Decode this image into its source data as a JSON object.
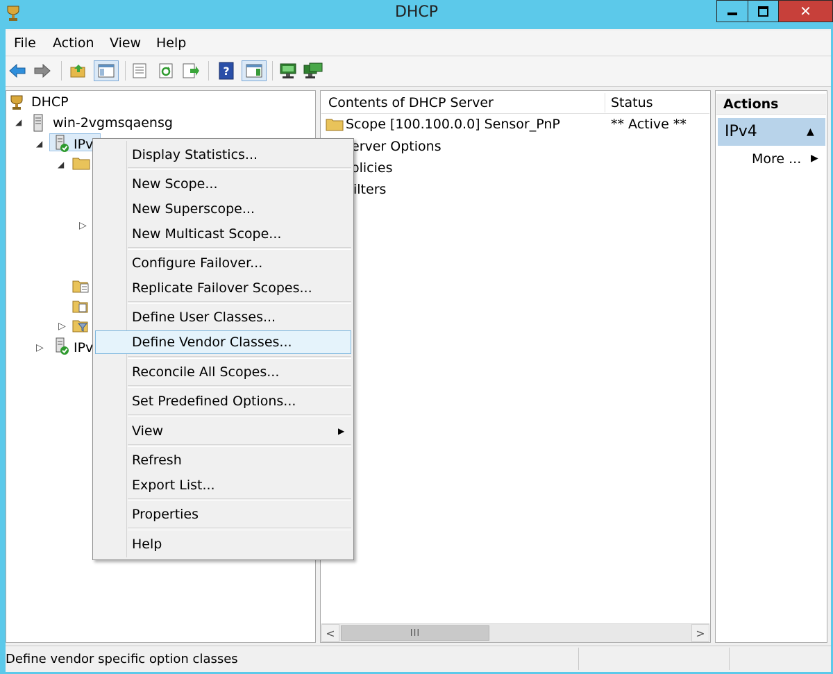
{
  "window": {
    "title": "DHCP",
    "controls": {
      "minimize": "minimize-icon",
      "maximize": "maximize-icon",
      "close": "close-icon"
    }
  },
  "menubar": {
    "items": [
      {
        "label": "File"
      },
      {
        "label": "Action"
      },
      {
        "label": "View"
      },
      {
        "label": "Help"
      }
    ]
  },
  "toolbar": {
    "buttons": [
      "back-arrow-icon",
      "forward-arrow-icon",
      "up-folder-icon",
      "show-hide-console-tree-icon",
      "properties-icon",
      "refresh-icon",
      "export-list-icon",
      "help-icon",
      "show-hide-action-pane-icon",
      "authorize-server-icon",
      "unauthorize-server-icon"
    ]
  },
  "tree": {
    "root": "DHCP",
    "server": "win-2vgmsqaensg",
    "ipv4": "IPv4",
    "ipv4_visible": "IPv",
    "ipv6_visible": "IPv"
  },
  "content": {
    "columns": [
      "Contents of DHCP Server",
      "Status"
    ],
    "rows": [
      {
        "name": "Scope [100.100.0.0] Sensor_PnP",
        "status": "** Active **"
      },
      {
        "name_visible": "erver Options",
        "status": ""
      },
      {
        "name_visible": "olicies",
        "status": ""
      },
      {
        "name_visible": "ilters",
        "status": ""
      }
    ]
  },
  "context_menu": {
    "items": [
      {
        "label": "Display Statistics..."
      },
      {
        "label": "New Scope..."
      },
      {
        "label": "New Superscope..."
      },
      {
        "label": "New Multicast Scope..."
      },
      {
        "label": "Configure Failover..."
      },
      {
        "label": "Replicate Failover Scopes..."
      },
      {
        "label": "Define User Classes..."
      },
      {
        "label": "Define Vendor Classes...",
        "highlighted": true
      },
      {
        "label": "Reconcile All Scopes..."
      },
      {
        "label": "Set Predefined Options..."
      },
      {
        "label": "View",
        "submenu": true
      },
      {
        "label": "Refresh"
      },
      {
        "label": "Export List..."
      },
      {
        "label": "Properties"
      },
      {
        "label": "Help"
      }
    ]
  },
  "actions": {
    "header": "Actions",
    "section": "IPv4",
    "items": [
      {
        "label": "More ..."
      }
    ]
  },
  "statusbar": {
    "text": "Define vendor specific option classes"
  },
  "colors": {
    "titlebar": "#5cc9ea",
    "close_button": "#c7403a",
    "menu_highlight": "#e5f3fb",
    "actions_section": "#b8d3ea"
  }
}
